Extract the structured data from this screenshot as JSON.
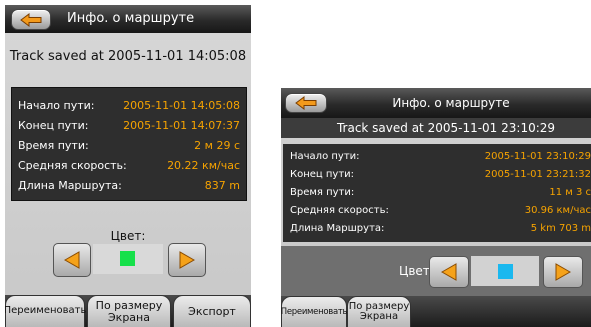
{
  "screen1": {
    "title": "Инфо. о маршруте",
    "saved": "Track saved at 2005-11-01 14:05:08",
    "rows": [
      {
        "label": "Начало пути:",
        "value": "2005-11-01 14:05:08"
      },
      {
        "label": "Конец пути:",
        "value": "2005-11-01 14:07:37"
      },
      {
        "label": "Время пути:",
        "value": "2 м 29 с"
      },
      {
        "label": "Средняя скорость:",
        "value": "20.22 км/час"
      },
      {
        "label": "Длина Маршрута:",
        "value": "837 m"
      }
    ],
    "color_label": "Цвет:",
    "swatch_color": "#16e04a",
    "buttons": {
      "rename": "Переименовать",
      "fit_line1": "По размеру",
      "fit_line2": "Экрана",
      "export": "Экспорт"
    }
  },
  "screen2": {
    "title": "Инфо. о маршруте",
    "saved": "Track saved at 2005-11-01 23:10:29",
    "rows": [
      {
        "label": "Начало пути:",
        "value": "2005-11-01 23:10:29"
      },
      {
        "label": "Конец пути:",
        "value": "2005-11-01 23:21:32"
      },
      {
        "label": "Время пути:",
        "value": "11 м  3 с"
      },
      {
        "label": "Средняя скорость:",
        "value": "30.96 км/час"
      },
      {
        "label": "Длина Маршрута:",
        "value": "5 km 703 m"
      }
    ],
    "color_label": "Цвет:",
    "swatch_color": "#1ab8ef",
    "buttons": {
      "rename": "Переименовать",
      "fit_line1": "По размеру",
      "fit_line2": "Экрана"
    }
  },
  "colors": {
    "value_text": "#f6a300",
    "table_bg": "#2e2e2e",
    "header_bg": "#2a2a2a"
  },
  "icons": {
    "back": "back-arrow-icon",
    "left": "arrow-left-icon",
    "right": "arrow-right-icon"
  }
}
